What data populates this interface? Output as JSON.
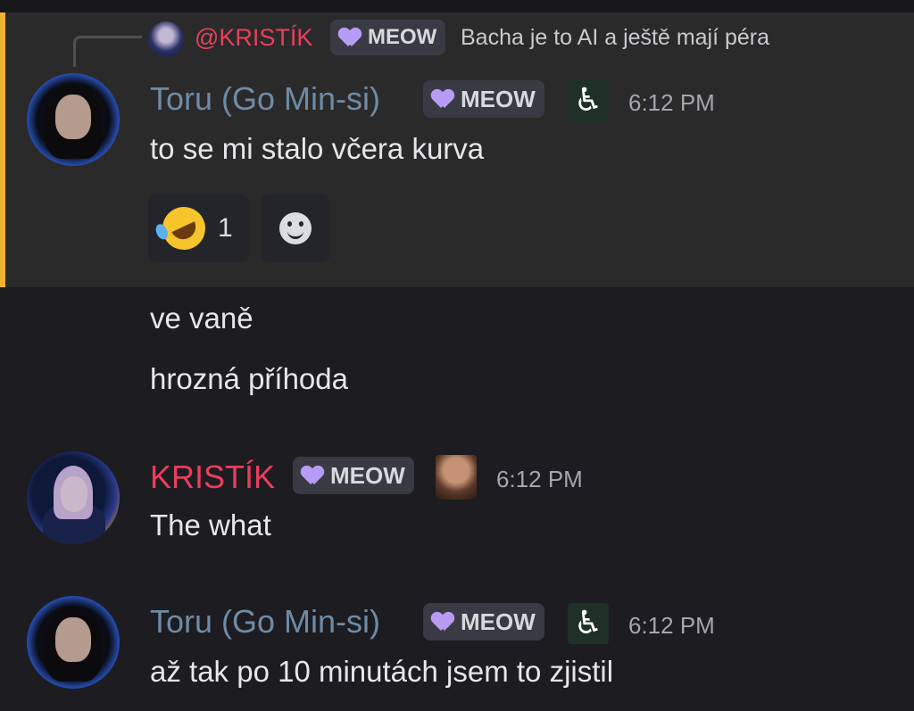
{
  "reply": {
    "author": "@KRISTÍK",
    "badge": "MEOW",
    "text": "Bacha je to AI a ještě mají péra"
  },
  "messages": [
    {
      "author": "Toru (Go Min-si)",
      "badge": "MEOW",
      "icon": "wheelchair-icon",
      "time": "6:12 PM",
      "text": "to se mi stalo včera kurva",
      "reactions": [
        {
          "emoji": "rolling-laughing-icon",
          "count": "1"
        }
      ]
    },
    {
      "text": "ve vaně"
    },
    {
      "text": "hrozná příhoda"
    },
    {
      "author": "KRISTÍK",
      "badge": "MEOW",
      "icon": "rock-face-icon",
      "time": "6:12 PM",
      "text": "The what"
    },
    {
      "author": "Toru (Go Min-si)",
      "badge": "MEOW",
      "icon": "wheelchair-icon",
      "time": "6:12 PM",
      "text": "až tak po 10 minutách jsem to zjistil"
    }
  ],
  "colors": {
    "background": "#1c1c21",
    "highlight": "#2b2a2a",
    "highlight_bar": "#f0b232",
    "toru_name": "#6e8ba6",
    "kristik_name": "#ec3d5c"
  }
}
